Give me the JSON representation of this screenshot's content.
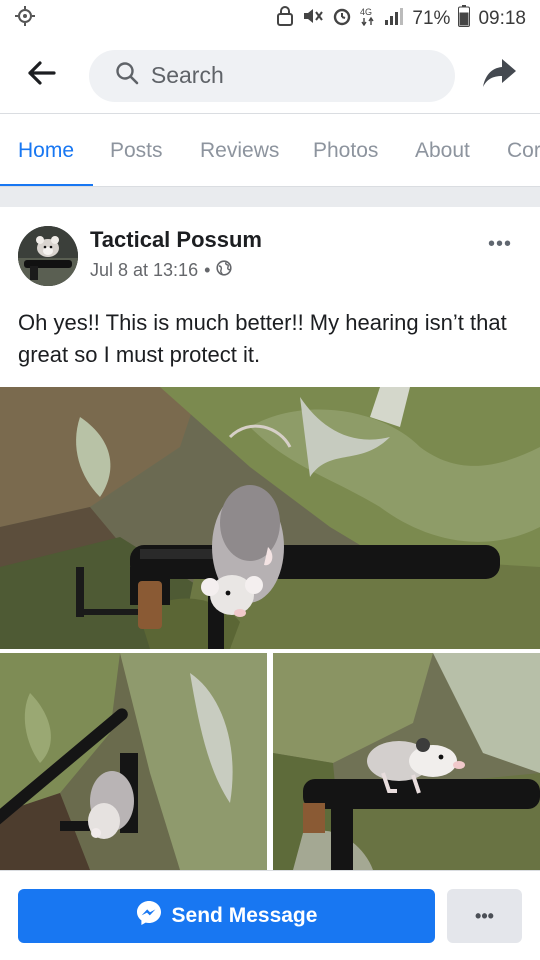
{
  "status_bar": {
    "battery": "71%",
    "time": "09:18",
    "left_icon": "settings-cog-icon",
    "icons": [
      "lock-icon",
      "mute-icon",
      "alarm-icon",
      "4g-icon",
      "signal-icon",
      "battery-icon"
    ]
  },
  "topbar": {
    "search_placeholder": "Search",
    "back_icon": "back-arrow-icon",
    "share_icon": "share-icon"
  },
  "tabs": [
    {
      "label": "Home",
      "active": true
    },
    {
      "label": "Posts",
      "active": false
    },
    {
      "label": "Reviews",
      "active": false
    },
    {
      "label": "Photos",
      "active": false
    },
    {
      "label": "About",
      "active": false
    },
    {
      "label": "Cor",
      "active": false
    }
  ],
  "post": {
    "author": "Tactical Possum",
    "date": "Jul 8 at 13:16",
    "separator": "•",
    "privacy_icon": "globe-icon",
    "more_label": "•••",
    "text": "Oh yes!! This is much better!! My hearing isn’t that great so I must protect it."
  },
  "actions": {
    "send_message": "Send Message",
    "more": "•••"
  },
  "colors": {
    "accent": "#1877f2",
    "text": "#1c1e21",
    "muted": "#65676b",
    "background": "#e9ebee"
  }
}
